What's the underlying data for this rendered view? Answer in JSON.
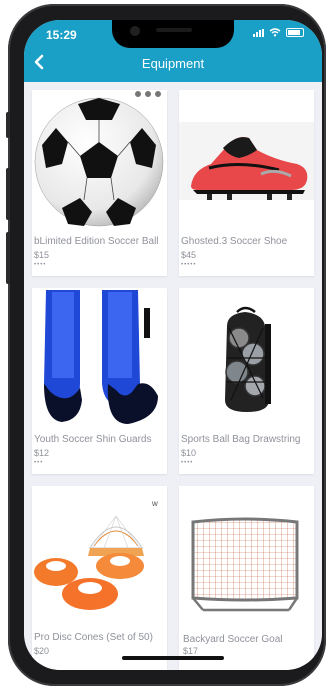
{
  "status": {
    "time": "15:29"
  },
  "header": {
    "title": "Equipment",
    "back_icon": "chevron-left-icon"
  },
  "products": [
    {
      "name": "bLimited Edition Soccer Ball",
      "price": "$15",
      "stars": "••••"
    },
    {
      "name": "Ghosted.3 Soccer Shoe",
      "price": "$45",
      "stars": "•••••"
    },
    {
      "name": "Youth Soccer Shin Guards",
      "price": "$12",
      "stars": "•••"
    },
    {
      "name": "Sports Ball Bag Drawstring",
      "price": "$10",
      "stars": "••••"
    },
    {
      "name": "Pro Disc Cones (Set of 50)",
      "price": "$20",
      "stars": ""
    },
    {
      "name": "Backyard Soccer Goal",
      "price": "$17",
      "stars": ""
    }
  ],
  "colors": {
    "header": "#1aa0c6",
    "background": "#eef0f6",
    "text_muted": "#8f929a"
  }
}
